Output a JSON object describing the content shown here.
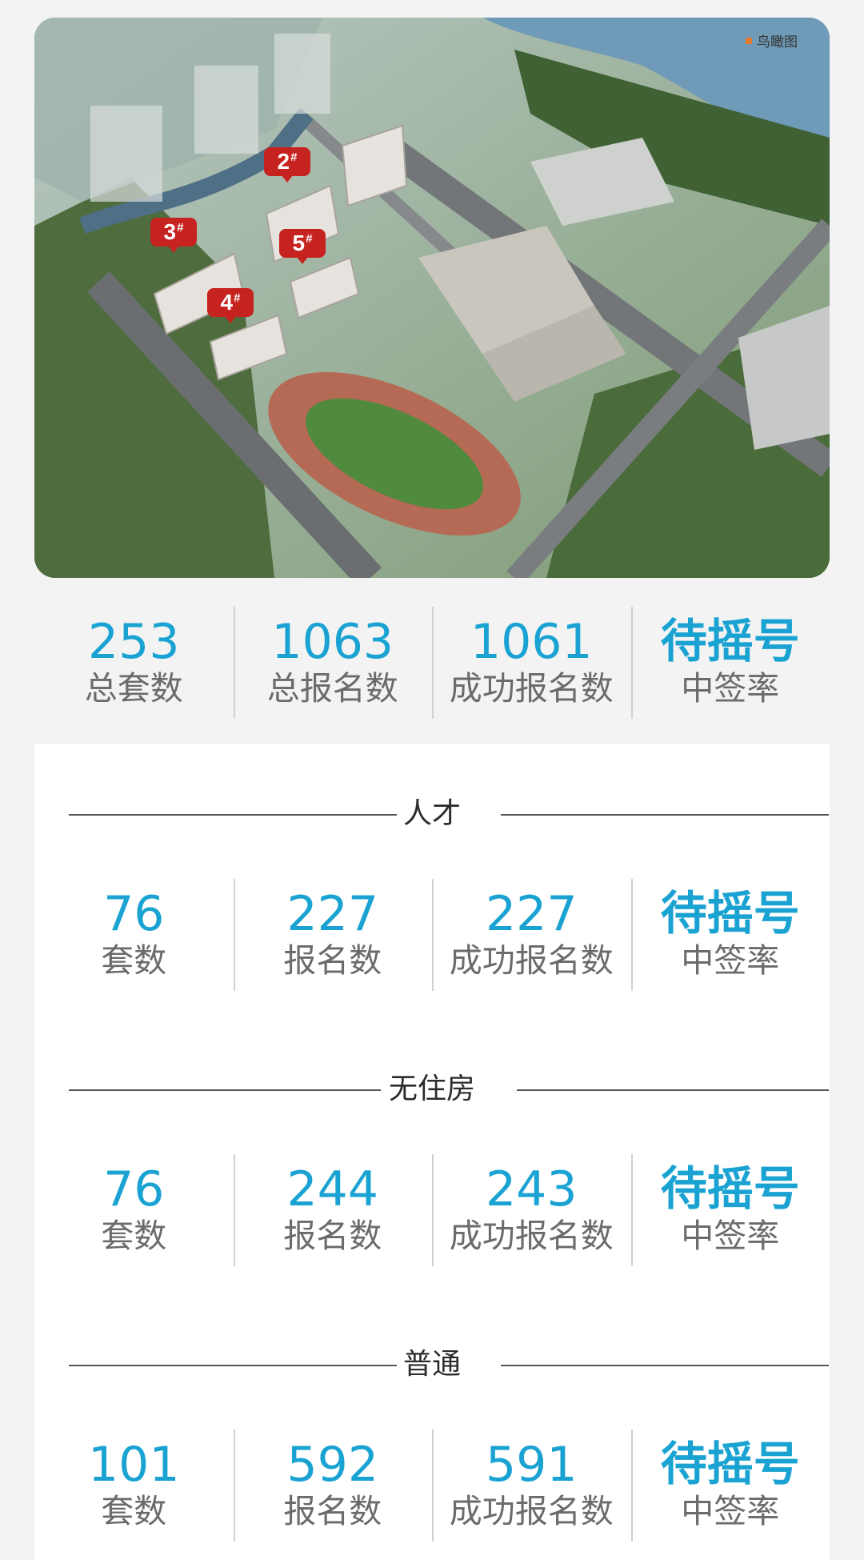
{
  "aerial": {
    "tag_label": "鸟瞰图",
    "building_marks": [
      "2#",
      "3#",
      "4#",
      "5#"
    ]
  },
  "summary": {
    "total_units": {
      "value": "253",
      "label": "总套数"
    },
    "total_signups": {
      "value": "1063",
      "label": "总报名数"
    },
    "successful_signups": {
      "value": "1061",
      "label": "成功报名数"
    },
    "win_rate": {
      "value": "待摇号",
      "label": "中签率"
    }
  },
  "sections": [
    {
      "title": "人才",
      "units": {
        "value": "76",
        "label": "套数"
      },
      "signups": {
        "value": "227",
        "label": "报名数"
      },
      "successful": {
        "value": "227",
        "label": "成功报名数"
      },
      "win_rate": {
        "value": "待摇号",
        "label": "中签率"
      }
    },
    {
      "title": "无住房",
      "units": {
        "value": "76",
        "label": "套数"
      },
      "signups": {
        "value": "244",
        "label": "报名数"
      },
      "successful": {
        "value": "243",
        "label": "成功报名数"
      },
      "win_rate": {
        "value": "待摇号",
        "label": "中签率"
      }
    },
    {
      "title": "普通",
      "units": {
        "value": "101",
        "label": "套数"
      },
      "signups": {
        "value": "592",
        "label": "报名数"
      },
      "successful": {
        "value": "591",
        "label": "成功报名数"
      },
      "win_rate": {
        "value": "待摇号",
        "label": "中签率"
      }
    }
  ],
  "colors": {
    "accent": "#1aa3d2",
    "label": "#6b6b6b",
    "marker": "#c6221f",
    "background": "#f3f3f4"
  }
}
